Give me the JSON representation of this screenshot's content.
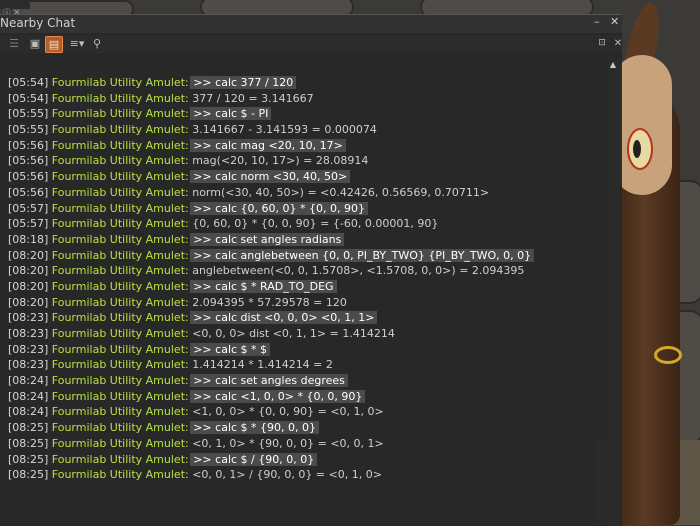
{
  "window": {
    "title": "Nearby Chat",
    "min_glyph": "–",
    "close_glyph": "✕"
  },
  "toolbar": {
    "people_glyph": "☰",
    "chat_glyph": "▣",
    "history_glyph": "▤",
    "options_glyph": "≡▾",
    "search_glyph": "⚲",
    "dock_glyph": "⊡",
    "popout_glyph": "✕"
  },
  "top_mini": {
    "label": "ⓘ ✕"
  },
  "scroll": {
    "up_glyph": "▲"
  },
  "chat_log": [
    {
      "time": "[05:54]",
      "sender": "Fourmilab Utility Amulet:",
      "message": ">> calc 377 / 120",
      "cmd": true
    },
    {
      "time": "[05:54]",
      "sender": "Fourmilab Utility Amulet:",
      "message": "377 / 120 = 3.141667",
      "cmd": false
    },
    {
      "time": "[05:55]",
      "sender": "Fourmilab Utility Amulet:",
      "message": ">> calc $ - PI",
      "cmd": true
    },
    {
      "time": "[05:55]",
      "sender": "Fourmilab Utility Amulet:",
      "message": "3.141667 - 3.141593 = 0.000074",
      "cmd": false
    },
    {
      "time": "[05:56]",
      "sender": "Fourmilab Utility Amulet:",
      "message": ">> calc mag <20, 10, 17>",
      "cmd": true
    },
    {
      "time": "[05:56]",
      "sender": "Fourmilab Utility Amulet:",
      "message": "mag(<20, 10, 17>) = 28.08914",
      "cmd": false
    },
    {
      "time": "[05:56]",
      "sender": "Fourmilab Utility Amulet:",
      "message": ">> calc norm <30, 40, 50>",
      "cmd": true
    },
    {
      "time": "[05:56]",
      "sender": "Fourmilab Utility Amulet:",
      "message": "norm(<30, 40, 50>) = <0.42426, 0.56569, 0.70711>",
      "cmd": false
    },
    {
      "time": "[05:57]",
      "sender": "Fourmilab Utility Amulet:",
      "message": ">> calc {0, 60, 0} * {0, 0, 90}",
      "cmd": true
    },
    {
      "time": "[05:57]",
      "sender": "Fourmilab Utility Amulet:",
      "message": "{0, 60, 0} * {0, 0, 90} = {-60, 0.00001, 90}",
      "cmd": false
    },
    {
      "time": "[08:18]",
      "sender": "Fourmilab Utility Amulet:",
      "message": ">> calc set angles radians",
      "cmd": true
    },
    {
      "time": "[08:20]",
      "sender": "Fourmilab Utility Amulet:",
      "message": ">> calc anglebetween {0, 0, PI_BY_TWO} {PI_BY_TWO, 0, 0}",
      "cmd": true
    },
    {
      "time": "[08:20]",
      "sender": "Fourmilab Utility Amulet:",
      "message": "anglebetween(<0, 0, 1.5708>, <1.5708, 0, 0>) = 2.094395",
      "cmd": false
    },
    {
      "time": "[08:20]",
      "sender": "Fourmilab Utility Amulet:",
      "message": ">> calc $ * RAD_TO_DEG",
      "cmd": true
    },
    {
      "time": "[08:20]",
      "sender": "Fourmilab Utility Amulet:",
      "message": "2.094395 * 57.29578 = 120",
      "cmd": false
    },
    {
      "time": "[08:23]",
      "sender": "Fourmilab Utility Amulet:",
      "message": ">> calc dist <0, 0, 0> <0, 1, 1>",
      "cmd": true
    },
    {
      "time": "[08:23]",
      "sender": "Fourmilab Utility Amulet:",
      "message": "<0, 0, 0> dist <0, 1, 1> = 1.414214",
      "cmd": false
    },
    {
      "time": "[08:23]",
      "sender": "Fourmilab Utility Amulet:",
      "message": ">> calc $ * $",
      "cmd": true
    },
    {
      "time": "[08:23]",
      "sender": "Fourmilab Utility Amulet:",
      "message": "1.414214 * 1.414214 = 2",
      "cmd": false
    },
    {
      "time": "[08:24]",
      "sender": "Fourmilab Utility Amulet:",
      "message": ">> calc set angles degrees",
      "cmd": true
    },
    {
      "time": "[08:24]",
      "sender": "Fourmilab Utility Amulet:",
      "message": ">> calc <1, 0, 0> * {0, 0, 90}",
      "cmd": true
    },
    {
      "time": "[08:24]",
      "sender": "Fourmilab Utility Amulet:",
      "message": "<1, 0, 0> * {0, 0, 90} = <0, 1, 0>",
      "cmd": false
    },
    {
      "time": "[08:25]",
      "sender": "Fourmilab Utility Amulet:",
      "message": ">> calc $ * {90, 0, 0}",
      "cmd": true
    },
    {
      "time": "[08:25]",
      "sender": "Fourmilab Utility Amulet:",
      "message": "<0, 1, 0> * {90, 0, 0} = <0, 0, 1>",
      "cmd": false
    },
    {
      "time": "[08:25]",
      "sender": "Fourmilab Utility Amulet:",
      "message": ">> calc $ / {90, 0, 0}",
      "cmd": true
    },
    {
      "time": "[08:25]",
      "sender": "Fourmilab Utility Amulet:",
      "message": "<0, 0, 1> / {90, 0, 0} = <0, 1, 0>",
      "cmd": false
    }
  ],
  "colors": {
    "sender": "#b8e040",
    "timestamp": "#d6d6d6",
    "history_active": "#b35d2a"
  }
}
